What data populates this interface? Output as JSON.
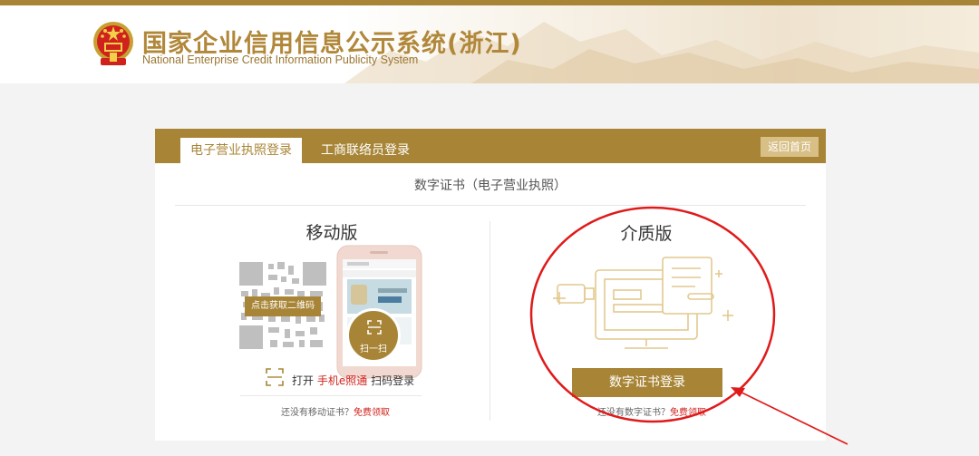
{
  "header": {
    "title": "国家企业信用信息公示系统(浙江)",
    "subtitle": "National Enterprise Credit Information Publicity System"
  },
  "tabs": [
    {
      "label": "电子营业执照登录",
      "active": true
    },
    {
      "label": "工商联络员登录",
      "active": false
    }
  ],
  "home_button": "返回首页",
  "cert_heading": "数字证书（电子营业执照）",
  "mobile": {
    "title": "移动版",
    "qr_button": "点击获取二维码",
    "scan_label": "扫一扫",
    "open_prefix": "打开",
    "open_app": "手机e照通",
    "open_suffix": "扫码登录",
    "note_prefix": "还没有移动证书？",
    "note_link": "免费领取"
  },
  "media": {
    "title": "介质版",
    "login_button": "数字证书登录",
    "note_prefix": "还没有数字证书？",
    "note_link": "免费领取"
  },
  "colors": {
    "accent": "#a88536",
    "highlight": "#d0221c",
    "annotation": "#e01a1a"
  },
  "icons": [
    "national-emblem-icon",
    "qr-code-icon",
    "phone-icon",
    "scan-icon",
    "computer-icon",
    "usb-key-icon",
    "certificate-icon"
  ]
}
